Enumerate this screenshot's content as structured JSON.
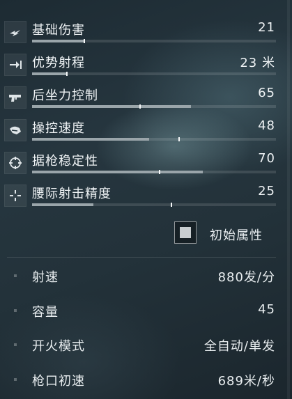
{
  "stats": [
    {
      "label": "基础伤害",
      "value": "21",
      "bar": 0.21,
      "marker": 0.21,
      "icon": "damage-icon"
    },
    {
      "label": "优势射程",
      "value": "23 米",
      "bar": 0.14,
      "marker": 0.14,
      "icon": "range-icon"
    },
    {
      "label": "后坐力控制",
      "value": "65",
      "bar": 0.65,
      "marker": 0.44,
      "icon": "recoil-icon"
    },
    {
      "label": "操控速度",
      "value": "48",
      "bar": 0.48,
      "marker": 0.6,
      "icon": "handling-icon"
    },
    {
      "label": "据枪稳定性",
      "value": "70",
      "bar": 0.7,
      "marker": 0.52,
      "icon": "crosshair-icon"
    },
    {
      "label": "腰际射击精度",
      "value": "25",
      "bar": 0.25,
      "marker": 0.57,
      "icon": "hipfire-icon"
    }
  ],
  "toggle": {
    "label": "初始属性",
    "checked": true
  },
  "specs": [
    {
      "label": "射速",
      "value": "880发/分"
    },
    {
      "label": "容量",
      "value": "45"
    },
    {
      "label": "开火模式",
      "value": "全自动/单发"
    },
    {
      "label": "枪口初速",
      "value": "689米/秒"
    }
  ],
  "colors": {
    "bar_fill": "#9aa5aa",
    "marker": "#f4f6f7",
    "text": "#eef2f4"
  }
}
